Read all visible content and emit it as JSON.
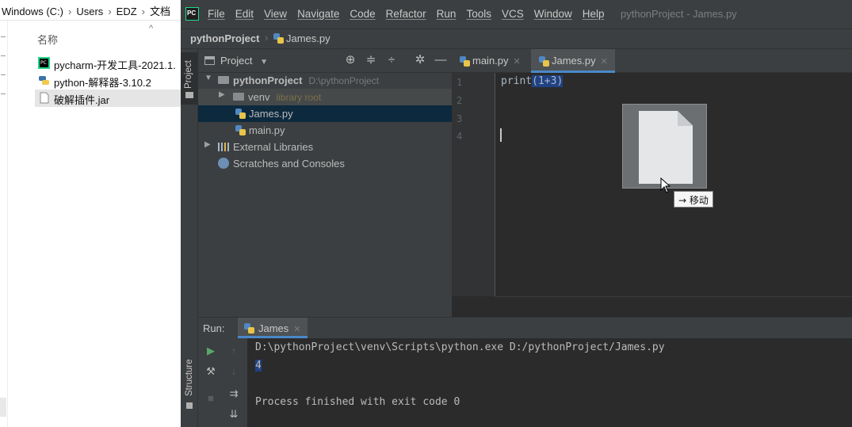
{
  "explorer": {
    "breadcrumb": [
      "Windows (C:)",
      "Users",
      "EDZ",
      "文档"
    ],
    "column_header": "名称",
    "sort_indicator": "^",
    "files": [
      {
        "name": "pycharm-开发工具-2021.1.",
        "icon": "pycharm-app-icon"
      },
      {
        "name": "python-解释器-3.10.2",
        "icon": "python-installer-icon"
      },
      {
        "name": "破解插件.jar",
        "icon": "jar-file-icon",
        "selected": true
      }
    ]
  },
  "pycharm": {
    "menu": [
      "File",
      "Edit",
      "View",
      "Navigate",
      "Code",
      "Refactor",
      "Run",
      "Tools",
      "VCS",
      "Window",
      "Help"
    ],
    "window_title": "pythonProject - James.py",
    "navbar": {
      "project": "pythonProject",
      "file": "James.py"
    },
    "side_stripe": {
      "project": "Project",
      "structure": "Structure"
    },
    "project_panel": {
      "title": "Project",
      "tree": {
        "root": {
          "name": "pythonProject",
          "path": "D:\\pythonProject"
        },
        "venv": {
          "name": "venv",
          "hint": "library root"
        },
        "file_james": "James.py",
        "file_main": "main.py",
        "external": "External Libraries",
        "scratches": "Scratches and Consoles"
      }
    },
    "editor": {
      "tabs": [
        "main.py",
        "James.py"
      ],
      "active_tab": "James.py",
      "line_numbers": [
        "1",
        "2",
        "3",
        "4"
      ],
      "code_prefix": "print",
      "code_selected": "(1+3)"
    },
    "drag_tooltip": "→ 移动",
    "run": {
      "label": "Run:",
      "tab": "James",
      "console": {
        "command": "D:\\pythonProject\\venv\\Scripts\\python.exe D:/pythonProject/James.py",
        "output": "4",
        "status": "Process finished with exit code 0"
      }
    },
    "colors": {
      "background": "#2b2b2b",
      "panel": "#3c3f41",
      "selection": "#214283",
      "accent": "#4a88c7"
    }
  }
}
